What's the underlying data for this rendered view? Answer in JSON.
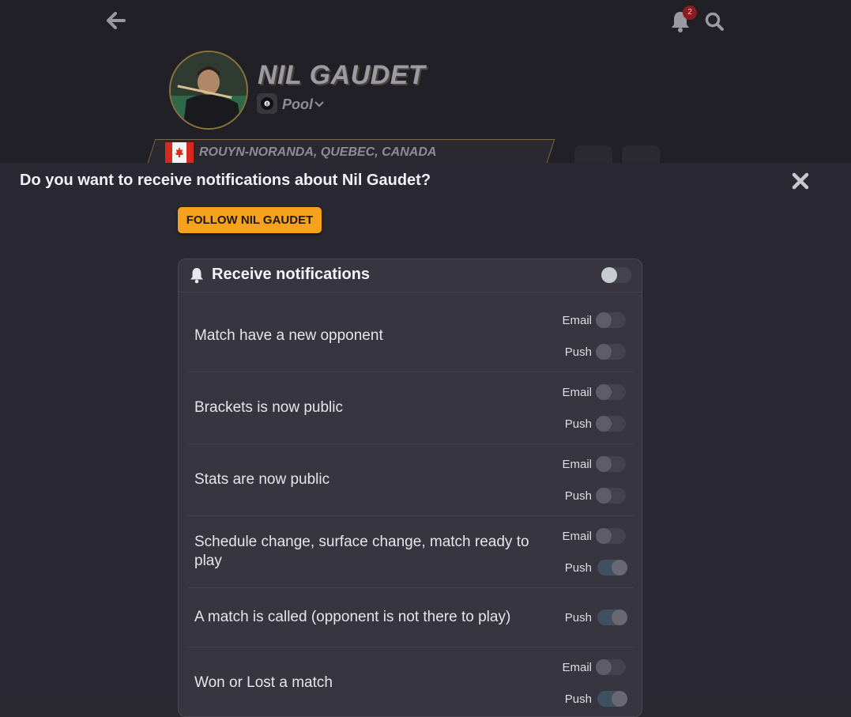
{
  "header": {
    "notification_count": "2"
  },
  "profile": {
    "name": "NIL GAUDET",
    "sport": "Pool",
    "location": "ROUYN-NORANDA, QUEBEC, CANADA"
  },
  "modal": {
    "title": "Do you want to receive notifications about Nil Gaudet?",
    "follow_label": "FOLLOW NIL GAUDET",
    "panel_title": "Receive notifications",
    "master_enabled": false,
    "email_label": "Email",
    "push_label": "Push",
    "rows": [
      {
        "label": "Match have a new opponent",
        "email": false,
        "push": false
      },
      {
        "label": "Brackets is now public",
        "email": false,
        "push": false
      },
      {
        "label": "Stats are now public",
        "email": false,
        "push": false
      },
      {
        "label": "Schedule change, surface change, match ready to play",
        "email": false,
        "push": true
      },
      {
        "label": "A match is called (opponent is not there to play)",
        "push": true
      },
      {
        "label": "Won or Lost a match",
        "email": false,
        "push": true
      }
    ]
  },
  "colors": {
    "accent": "#f6a21c",
    "badge": "#8a1c22"
  }
}
